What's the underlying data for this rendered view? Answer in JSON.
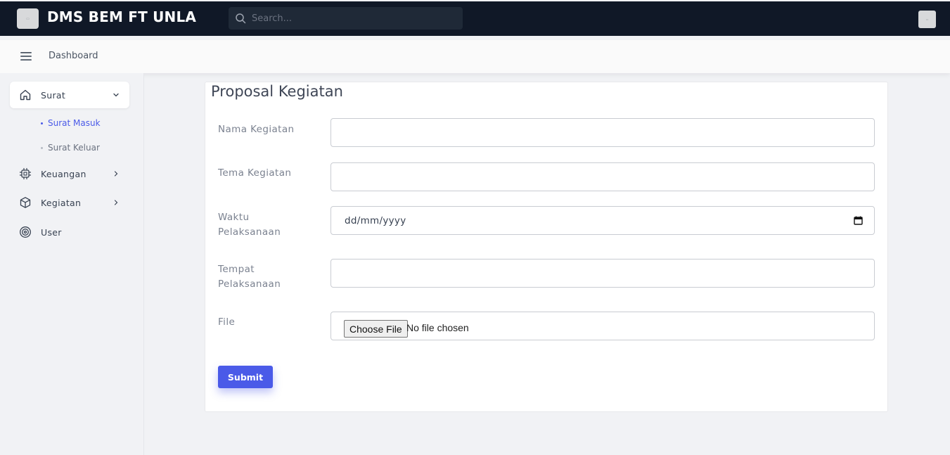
{
  "app": {
    "brand": "DMS BEM FT UNLA",
    "search_placeholder": "Search..."
  },
  "header": {
    "breadcrumb": "Dashboard"
  },
  "sidebar": {
    "items": [
      {
        "label": "Surat",
        "icon": "home-icon",
        "expanded": true
      },
      {
        "label": "Keuangan",
        "icon": "chip-icon"
      },
      {
        "label": "Kegiatan",
        "icon": "cube-icon"
      },
      {
        "label": "User",
        "icon": "target-icon"
      }
    ],
    "subitems": [
      {
        "label": "Surat Masuk",
        "active": true
      },
      {
        "label": "Surat Keluar",
        "active": false
      }
    ]
  },
  "form": {
    "title": "Proposal Kegiatan",
    "fields": {
      "nama": {
        "label": "Nama Kegiatan",
        "value": ""
      },
      "tema": {
        "label": "Tema Kegiatan",
        "value": ""
      },
      "waktu": {
        "label_line1": "Waktu",
        "label_line2": "Pelaksanaan",
        "placeholder": "dd/mm/yyyy"
      },
      "tempat": {
        "label_line1": "Tempat",
        "label_line2": "Pelaksanaan",
        "value": ""
      },
      "file": {
        "label": "File",
        "button": "Choose File",
        "status": "No file chosen"
      }
    },
    "submit_label": "Submit"
  },
  "colors": {
    "topbar": "#101827",
    "accent": "#4a5ae8",
    "active_subitem": "#4a5ae8"
  }
}
